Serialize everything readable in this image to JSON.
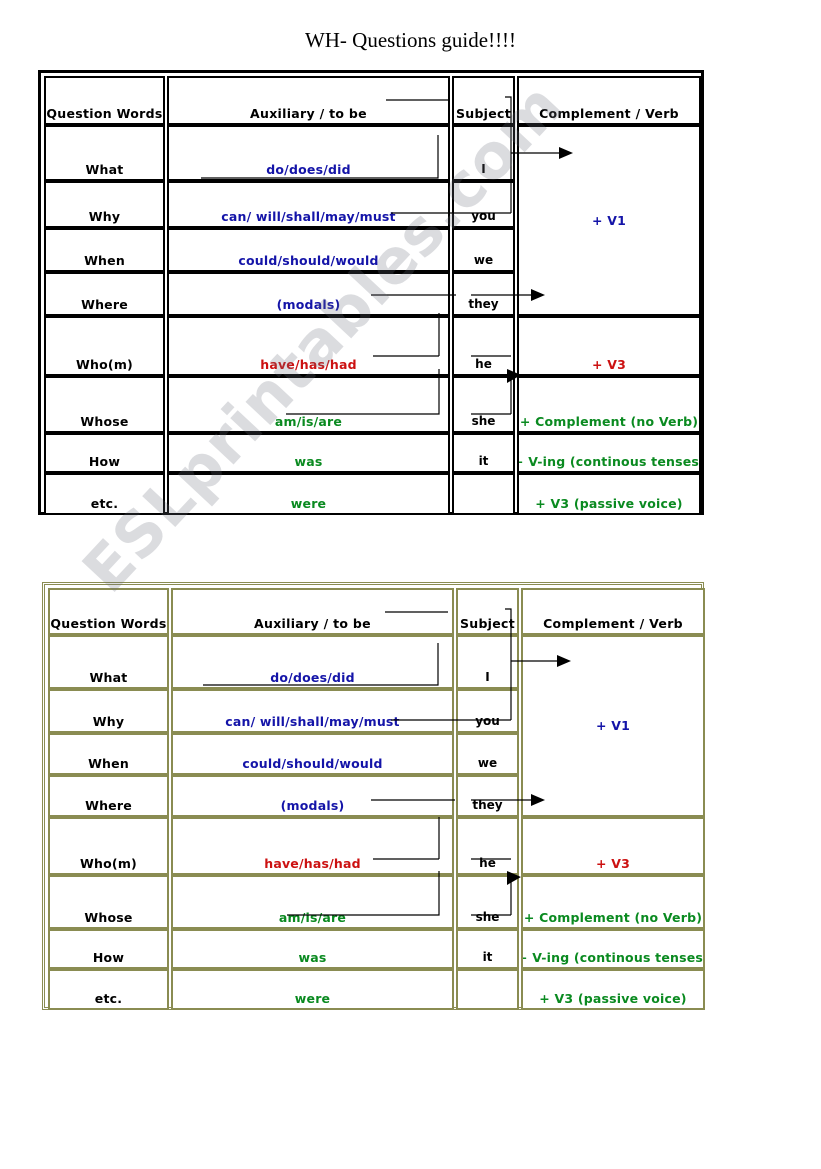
{
  "document": {
    "title": "WH- Questions guide!!!!",
    "watermark": "ESLprintables.com"
  },
  "colors": {
    "blue": "#1414a8",
    "red": "#cc1111",
    "green": "#0a8a20",
    "black": "#000000",
    "table1_border": "#000000",
    "table2_border": "#8a8c52"
  },
  "columns": {
    "question_words": "Question Words",
    "auxiliary": "Auxiliary / to be",
    "subject": "Subject",
    "complement": "Complement / Verb"
  },
  "table1": {
    "headers": [
      "Question Words",
      "Auxiliary / to be",
      "Subject",
      "Complement / Verb"
    ],
    "rows": [
      {
        "question_word": "What",
        "auxiliary": "do/does/did",
        "aux_color": "blue",
        "subject": "I"
      },
      {
        "question_word": "Why",
        "auxiliary": "can/ will/shall/may/must",
        "aux_color": "blue",
        "subject": "you"
      },
      {
        "question_word": "When",
        "auxiliary": "could/should/would",
        "aux_color": "blue",
        "subject": "we"
      },
      {
        "question_word": "Where",
        "auxiliary": "(modals)",
        "aux_color": "blue",
        "subject": "they"
      },
      {
        "question_word": "Who(m)",
        "auxiliary": "have/has/had",
        "aux_color": "red",
        "subject": "he"
      },
      {
        "question_word": "Whose",
        "auxiliary": "am/is/are",
        "aux_color": "green",
        "subject": "she"
      },
      {
        "question_word": "How",
        "auxiliary": "was",
        "aux_color": "green",
        "subject": "it"
      },
      {
        "question_word": "etc.",
        "auxiliary": "were",
        "aux_color": "green",
        "subject": ""
      }
    ],
    "complements": [
      {
        "text": "+ V1",
        "color": "blue",
        "spans_rows": 4
      },
      {
        "text": "+ V3",
        "color": "red",
        "spans_rows": 1
      },
      {
        "text": "+ Complement (no Verb)",
        "color": "green",
        "spans_rows": 1
      },
      {
        "text": "+ V-ing (continous tenses)",
        "color": "green",
        "spans_rows": 1
      },
      {
        "text": "+ V3 (passive voice)",
        "color": "green",
        "spans_rows": 1
      }
    ]
  },
  "table2": {
    "headers": [
      "Question Words",
      "Auxiliary / to be",
      "Subject",
      "Complement / Verb"
    ],
    "rows": [
      {
        "question_word": "What",
        "auxiliary": "do/does/did",
        "aux_color": "blue",
        "subject": "I"
      },
      {
        "question_word": "Why",
        "auxiliary": "can/ will/shall/may/must",
        "aux_color": "blue",
        "subject": "you"
      },
      {
        "question_word": "When",
        "auxiliary": "could/should/would",
        "aux_color": "blue",
        "subject": "we"
      },
      {
        "question_word": "Where",
        "auxiliary": "(modals)",
        "aux_color": "blue",
        "subject": "they"
      },
      {
        "question_word": "Who(m)",
        "auxiliary": "have/has/had",
        "aux_color": "red",
        "subject": "he"
      },
      {
        "question_word": "Whose",
        "auxiliary": "am/is/are",
        "aux_color": "green",
        "subject": "she"
      },
      {
        "question_word": "How",
        "auxiliary": "was",
        "aux_color": "green",
        "subject": "it"
      },
      {
        "question_word": "etc.",
        "auxiliary": "were",
        "aux_color": "green",
        "subject": ""
      }
    ],
    "complements": [
      {
        "text": "+ V1",
        "color": "blue",
        "spans_rows": 4
      },
      {
        "text": "+ V3",
        "color": "red",
        "spans_rows": 1
      },
      {
        "text": "+ Complement (no Verb)",
        "color": "green",
        "spans_rows": 1
      },
      {
        "text": "+ V-ing (continous tenses)",
        "color": "green",
        "spans_rows": 1
      },
      {
        "text": "+ V3 (passive voice)",
        "color": "green",
        "spans_rows": 1
      }
    ]
  }
}
